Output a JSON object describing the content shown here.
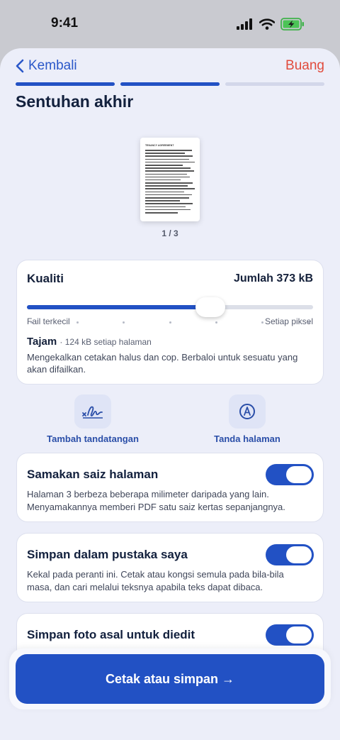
{
  "status_bar": {
    "time": "9:41"
  },
  "nav": {
    "back_label": "Kembali",
    "discard_label": "Buang",
    "steps_total": 3,
    "steps_done": 2
  },
  "title": "Sentuhan akhir",
  "preview": {
    "doc_heading": "TENANCY AGREEMENT",
    "page_indicator": "1 / 3"
  },
  "quality": {
    "label": "Kualiti",
    "total": "Jumlah 373 kB",
    "level_fraction": 0.64,
    "tick_count": 7,
    "min_label": "Fail terkecil",
    "max_label": "Setiap piksel",
    "setting_name": "Tajam",
    "setting_detail": "· 124 kB setiap halaman",
    "description": "Mengekalkan cetakan halus dan cop. Berbaloi untuk sesuatu yang akan difailkan."
  },
  "actions": [
    {
      "label": "Tambah tandatangan",
      "icon": "signature-icon"
    },
    {
      "label": "Tanda halaman",
      "icon": "pen-mark-icon"
    }
  ],
  "toggles": [
    {
      "title": "Samakan saiz halaman",
      "description": "Halaman 3 berbeza beberapa milimeter daripada yang lain. Menyamakannya memberi PDF satu saiz kertas sepanjangnya.",
      "on": true
    },
    {
      "title": "Simpan dalam pustaka saya",
      "description": "Kekal pada peranti ini. Cetak atau kongsi semula pada bila-bila masa, dan cari melalui teksnya apabila teks dapat dibaca.",
      "on": true
    },
    {
      "title": "Simpan foto asal untuk diedit",
      "description": "",
      "on": true
    }
  ],
  "cta": {
    "label": "Cetak atau simpan →"
  },
  "colors": {
    "accent": "#2251c4",
    "danger": "#e14b3c",
    "background": "#eceef9",
    "card": "#ffffff"
  }
}
